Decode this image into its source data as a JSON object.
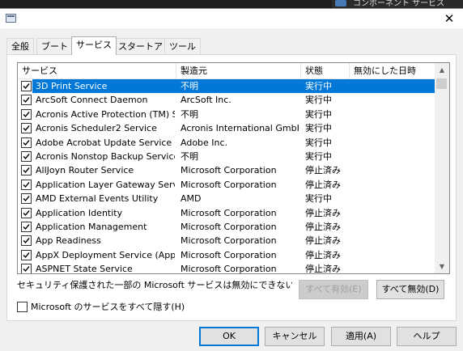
{
  "background": {
    "taskbar_text": "コンポーネント サービス"
  },
  "window": {
    "close_glyph": "✕"
  },
  "tabs": [
    {
      "label": "全般",
      "active": false
    },
    {
      "label": "ブート",
      "active": false
    },
    {
      "label": "サービス",
      "active": true
    },
    {
      "label": "スタートアップ",
      "active": false
    },
    {
      "label": "ツール",
      "active": false
    }
  ],
  "columns": [
    "サービス",
    "製造元",
    "状態",
    "無効にした日時"
  ],
  "services": [
    {
      "name": "3D Print Service",
      "maker": "不明",
      "status": "実行中",
      "checked": true,
      "selected": true
    },
    {
      "name": "ArcSoft Connect Daemon",
      "maker": "ArcSoft Inc.",
      "status": "実行中",
      "checked": true
    },
    {
      "name": "Acronis Active Protection (TM) Serv...",
      "maker": "不明",
      "status": "実行中",
      "checked": true
    },
    {
      "name": "Acronis Scheduler2 Service",
      "maker": "Acronis International GmbH",
      "status": "実行中",
      "checked": true
    },
    {
      "name": "Adobe Acrobat Update Service",
      "maker": "Adobe Inc.",
      "status": "実行中",
      "checked": true
    },
    {
      "name": "Acronis Nonstop Backup Service",
      "maker": "不明",
      "status": "実行中",
      "checked": true
    },
    {
      "name": "AllJoyn Router Service",
      "maker": "Microsoft Corporation",
      "status": "停止済み",
      "checked": true
    },
    {
      "name": "Application Layer Gateway Service",
      "maker": "Microsoft Corporation",
      "status": "停止済み",
      "checked": true
    },
    {
      "name": "AMD External Events Utility",
      "maker": "AMD",
      "status": "実行中",
      "checked": true
    },
    {
      "name": "Application Identity",
      "maker": "Microsoft Corporation",
      "status": "停止済み",
      "checked": true
    },
    {
      "name": "Application Management",
      "maker": "Microsoft Corporation",
      "status": "停止済み",
      "checked": true
    },
    {
      "name": "App Readiness",
      "maker": "Microsoft Corporation",
      "status": "停止済み",
      "checked": true
    },
    {
      "name": "AppX Deployment Service (AppXS...",
      "maker": "Microsoft Corporation",
      "status": "停止済み",
      "checked": true
    },
    {
      "name": "ASPNET State Service",
      "maker": "Microsoft Corporation",
      "status": "停止済み",
      "checked": true
    }
  ],
  "note_text": "セキュリティ保護された一部の Microsoft サービスは無効にできない場合があります。",
  "enable_all_label": "すべて有効(E)",
  "disable_all_label": "すべて無効(D)",
  "hide_ms_label": "Microsoft のサービスをすべて隠す(H)",
  "hide_ms_checked": false,
  "buttons": {
    "ok": "OK",
    "cancel": "キャンセル",
    "apply": "適用(A)",
    "help": "ヘルプ"
  },
  "scroll": {
    "up": "▲",
    "down": "▼"
  }
}
